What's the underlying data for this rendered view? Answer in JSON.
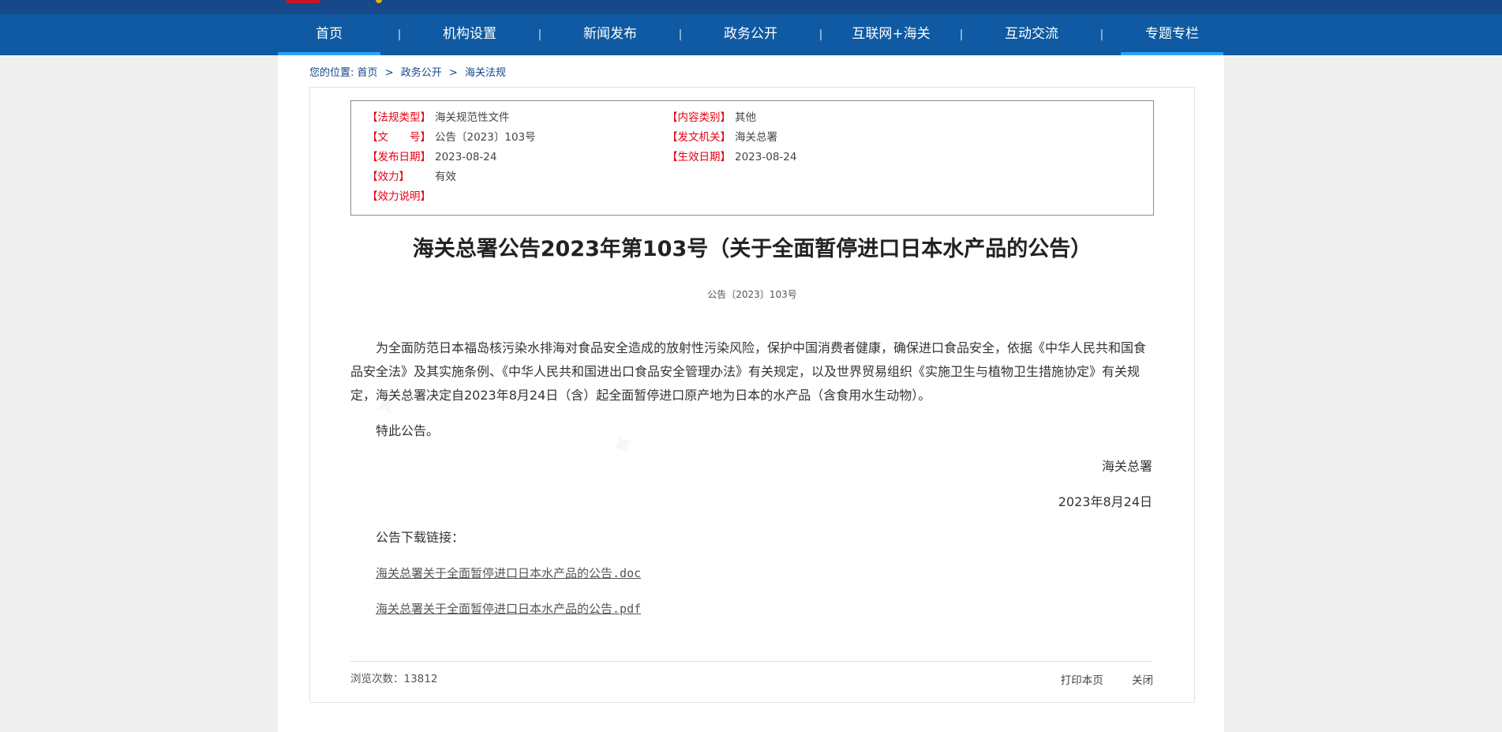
{
  "nav": {
    "items": [
      "首页",
      "机构设置",
      "新闻发布",
      "政务公开",
      "互联网+海关",
      "互动交流",
      "专题专栏"
    ],
    "separator": "|"
  },
  "breadcrumb": {
    "prefix": "您的位置:",
    "items": [
      "首页",
      "政务公开",
      "海关法规"
    ],
    "separator": ">"
  },
  "meta": {
    "type_label": "【法规类型】",
    "type_value": "海关规范性文件",
    "doc_label": "【文　　号】",
    "doc_value": "公告〔2023〕103号",
    "date_label": "【发布日期】",
    "date_value": "2023-08-24",
    "effect_label": "【效力】",
    "effect_value": "有效",
    "effect_note_label": "【效力说明】",
    "category_label": "【内容类别】",
    "category_value": "其他",
    "issuer_label": "【发文机关】",
    "issuer_value": "海关总署",
    "effective_date_label": "【生效日期】",
    "effective_date_value": "2023-08-24"
  },
  "article": {
    "title": "海关总署公告2023年第103号（关于全面暂停进口日本水产品的公告）",
    "subtitle": "公告〔2023〕103号",
    "body": "为全面防范日本福岛核污染水排海对食品安全造成的放射性污染风险，保护中国消费者健康，确保进口食品安全，依据《中华人民共和国食品安全法》及其实施条例、《中华人民共和国进出口食品安全管理办法》有关规定，以及世界贸易组织《实施卫生与植物卫生措施协定》有关规定，海关总署决定自2023年8月24日（含）起全面暂停进口原产地为日本的水产品（含食用水生动物）。",
    "closing": "特此公告。",
    "signature": "海关总署",
    "date": "2023年8月24日",
    "download_label": "公告下载链接：",
    "link_doc": "海关总署关于全面暂停进口日本水产品的公告.doc",
    "link_pdf": "海关总署关于全面暂停进口日本水产品的公告.pdf"
  },
  "footer": {
    "views_label": "浏览次数：",
    "views": "13812",
    "print": "打印本页",
    "close": "关闭"
  },
  "colors": {
    "nav_bg": "#0f5aa2",
    "top_bg": "#17498a",
    "active_underline": "#2aa3f5",
    "label_red": "#e60012",
    "breadcrumb_blue": "#13478a"
  }
}
